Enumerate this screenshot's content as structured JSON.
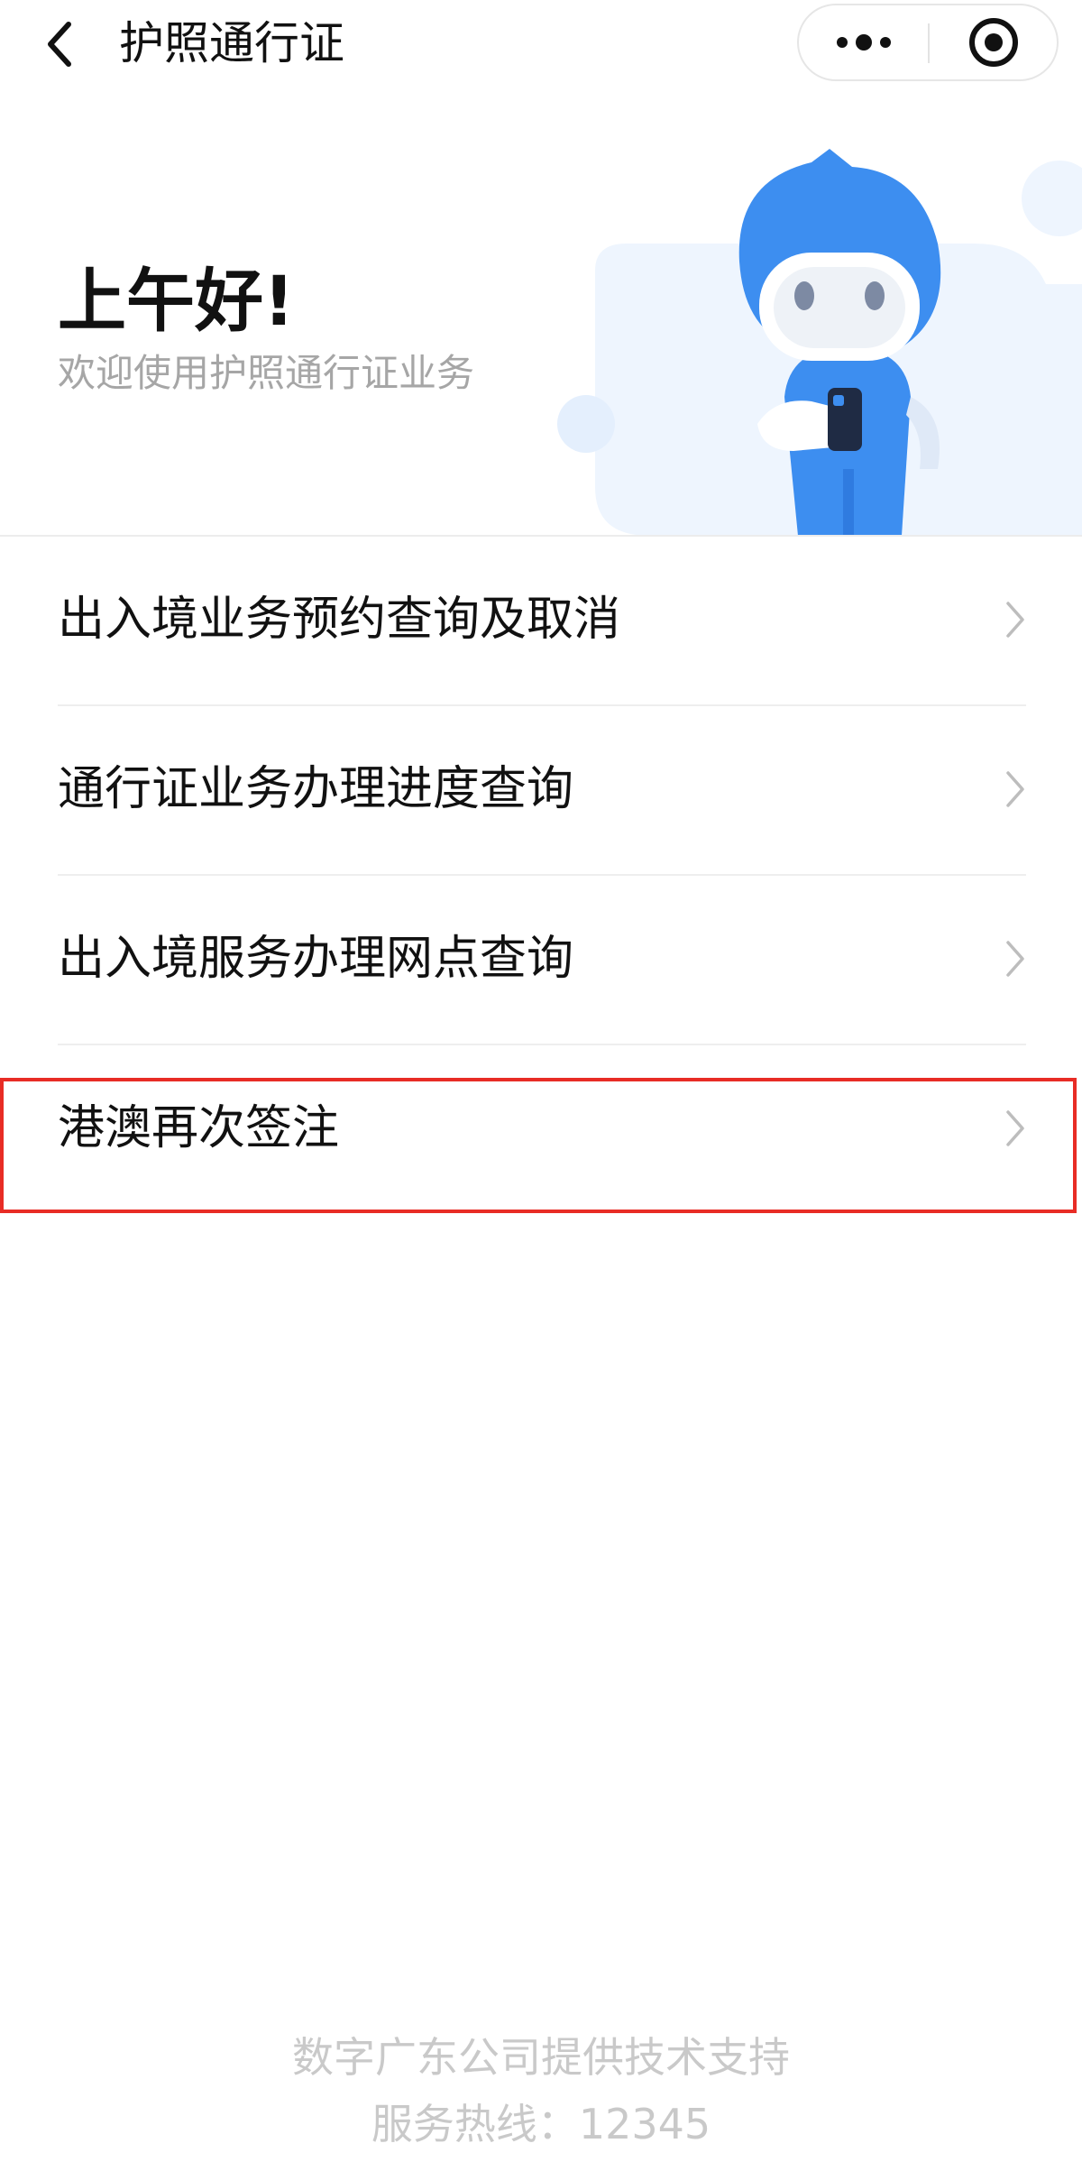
{
  "nav": {
    "title": "护照通行证",
    "back_icon": "chevron-left-icon",
    "more_icon": "more-dots-icon",
    "close_icon": "target-circle-icon"
  },
  "hero": {
    "greeting": "上午好!",
    "welcome": "欢迎使用护照通行证业务",
    "mascot": "blue-robot-mascot-holding-phone"
  },
  "menu": {
    "items": [
      {
        "label": "出入境业务预约查询及取消",
        "icon": "chevron-right-icon"
      },
      {
        "label": "通行证业务办理进度查询",
        "icon": "chevron-right-icon"
      },
      {
        "label": "出入境服务办理网点查询",
        "icon": "chevron-right-icon"
      },
      {
        "label": "港澳再次签注",
        "icon": "chevron-right-icon",
        "highlighted": true
      }
    ]
  },
  "footer": {
    "provider": "数字广东公司提供技术支持",
    "hotline": "服务热线：12345"
  },
  "colors": {
    "mascot_blue": "#3d8ef0",
    "highlight_red": "#e82c25",
    "bg_shape": "#eef5fe"
  }
}
